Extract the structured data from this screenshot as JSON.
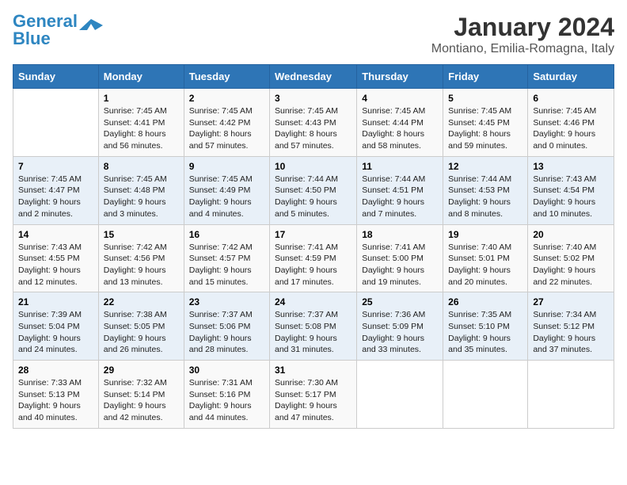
{
  "logo": {
    "line1": "General",
    "line2": "Blue"
  },
  "title": "January 2024",
  "subtitle": "Montiano, Emilia-Romagna, Italy",
  "headers": [
    "Sunday",
    "Monday",
    "Tuesday",
    "Wednesday",
    "Thursday",
    "Friday",
    "Saturday"
  ],
  "weeks": [
    [
      {
        "day": "",
        "content": ""
      },
      {
        "day": "1",
        "content": "Sunrise: 7:45 AM\nSunset: 4:41 PM\nDaylight: 8 hours\nand 56 minutes."
      },
      {
        "day": "2",
        "content": "Sunrise: 7:45 AM\nSunset: 4:42 PM\nDaylight: 8 hours\nand 57 minutes."
      },
      {
        "day": "3",
        "content": "Sunrise: 7:45 AM\nSunset: 4:43 PM\nDaylight: 8 hours\nand 57 minutes."
      },
      {
        "day": "4",
        "content": "Sunrise: 7:45 AM\nSunset: 4:44 PM\nDaylight: 8 hours\nand 58 minutes."
      },
      {
        "day": "5",
        "content": "Sunrise: 7:45 AM\nSunset: 4:45 PM\nDaylight: 8 hours\nand 59 minutes."
      },
      {
        "day": "6",
        "content": "Sunrise: 7:45 AM\nSunset: 4:46 PM\nDaylight: 9 hours\nand 0 minutes."
      }
    ],
    [
      {
        "day": "7",
        "content": "Sunrise: 7:45 AM\nSunset: 4:47 PM\nDaylight: 9 hours\nand 2 minutes."
      },
      {
        "day": "8",
        "content": "Sunrise: 7:45 AM\nSunset: 4:48 PM\nDaylight: 9 hours\nand 3 minutes."
      },
      {
        "day": "9",
        "content": "Sunrise: 7:45 AM\nSunset: 4:49 PM\nDaylight: 9 hours\nand 4 minutes."
      },
      {
        "day": "10",
        "content": "Sunrise: 7:44 AM\nSunset: 4:50 PM\nDaylight: 9 hours\nand 5 minutes."
      },
      {
        "day": "11",
        "content": "Sunrise: 7:44 AM\nSunset: 4:51 PM\nDaylight: 9 hours\nand 7 minutes."
      },
      {
        "day": "12",
        "content": "Sunrise: 7:44 AM\nSunset: 4:53 PM\nDaylight: 9 hours\nand 8 minutes."
      },
      {
        "day": "13",
        "content": "Sunrise: 7:43 AM\nSunset: 4:54 PM\nDaylight: 9 hours\nand 10 minutes."
      }
    ],
    [
      {
        "day": "14",
        "content": "Sunrise: 7:43 AM\nSunset: 4:55 PM\nDaylight: 9 hours\nand 12 minutes."
      },
      {
        "day": "15",
        "content": "Sunrise: 7:42 AM\nSunset: 4:56 PM\nDaylight: 9 hours\nand 13 minutes."
      },
      {
        "day": "16",
        "content": "Sunrise: 7:42 AM\nSunset: 4:57 PM\nDaylight: 9 hours\nand 15 minutes."
      },
      {
        "day": "17",
        "content": "Sunrise: 7:41 AM\nSunset: 4:59 PM\nDaylight: 9 hours\nand 17 minutes."
      },
      {
        "day": "18",
        "content": "Sunrise: 7:41 AM\nSunset: 5:00 PM\nDaylight: 9 hours\nand 19 minutes."
      },
      {
        "day": "19",
        "content": "Sunrise: 7:40 AM\nSunset: 5:01 PM\nDaylight: 9 hours\nand 20 minutes."
      },
      {
        "day": "20",
        "content": "Sunrise: 7:40 AM\nSunset: 5:02 PM\nDaylight: 9 hours\nand 22 minutes."
      }
    ],
    [
      {
        "day": "21",
        "content": "Sunrise: 7:39 AM\nSunset: 5:04 PM\nDaylight: 9 hours\nand 24 minutes."
      },
      {
        "day": "22",
        "content": "Sunrise: 7:38 AM\nSunset: 5:05 PM\nDaylight: 9 hours\nand 26 minutes."
      },
      {
        "day": "23",
        "content": "Sunrise: 7:37 AM\nSunset: 5:06 PM\nDaylight: 9 hours\nand 28 minutes."
      },
      {
        "day": "24",
        "content": "Sunrise: 7:37 AM\nSunset: 5:08 PM\nDaylight: 9 hours\nand 31 minutes."
      },
      {
        "day": "25",
        "content": "Sunrise: 7:36 AM\nSunset: 5:09 PM\nDaylight: 9 hours\nand 33 minutes."
      },
      {
        "day": "26",
        "content": "Sunrise: 7:35 AM\nSunset: 5:10 PM\nDaylight: 9 hours\nand 35 minutes."
      },
      {
        "day": "27",
        "content": "Sunrise: 7:34 AM\nSunset: 5:12 PM\nDaylight: 9 hours\nand 37 minutes."
      }
    ],
    [
      {
        "day": "28",
        "content": "Sunrise: 7:33 AM\nSunset: 5:13 PM\nDaylight: 9 hours\nand 40 minutes."
      },
      {
        "day": "29",
        "content": "Sunrise: 7:32 AM\nSunset: 5:14 PM\nDaylight: 9 hours\nand 42 minutes."
      },
      {
        "day": "30",
        "content": "Sunrise: 7:31 AM\nSunset: 5:16 PM\nDaylight: 9 hours\nand 44 minutes."
      },
      {
        "day": "31",
        "content": "Sunrise: 7:30 AM\nSunset: 5:17 PM\nDaylight: 9 hours\nand 47 minutes."
      },
      {
        "day": "",
        "content": ""
      },
      {
        "day": "",
        "content": ""
      },
      {
        "day": "",
        "content": ""
      }
    ]
  ]
}
